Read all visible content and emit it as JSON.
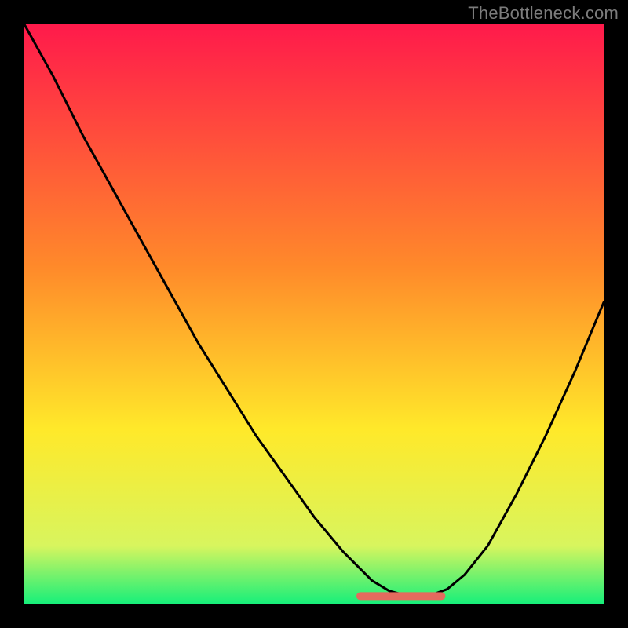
{
  "watermark": "TheBottleneck.com",
  "colors": {
    "frame": "#000000",
    "grad_top": "#ff1a4b",
    "grad_mid": "#fff22a",
    "grad_bot": "#17ef7a",
    "curve": "#000000",
    "marker": "#e46a5e",
    "watermark": "#7c7c7c"
  },
  "chart_data": {
    "type": "line",
    "title": "",
    "xlabel": "",
    "ylabel": "",
    "xlim": [
      0,
      100
    ],
    "ylim": [
      0,
      100
    ],
    "axes_visible": false,
    "background": "vertical-gradient red→yellow→green",
    "series": [
      {
        "name": "bottleneck-curve",
        "x": [
          0.0,
          5,
          10,
          15,
          20,
          25,
          30,
          35,
          40,
          45,
          50,
          55,
          58,
          60,
          63,
          66,
          68,
          70,
          73,
          76,
          80,
          85,
          90,
          95,
          100
        ],
        "y": [
          100,
          91,
          81,
          72,
          63,
          54,
          45,
          37,
          29,
          22,
          15,
          9,
          6,
          4,
          2.2,
          1.4,
          1.2,
          1.4,
          2.5,
          5,
          10,
          19,
          29,
          40,
          52
        ]
      }
    ],
    "flat_region": {
      "x_start": 58,
      "x_end": 72,
      "y": 1.3,
      "note": "pink rounded segment marking bottleneck minimum"
    }
  }
}
